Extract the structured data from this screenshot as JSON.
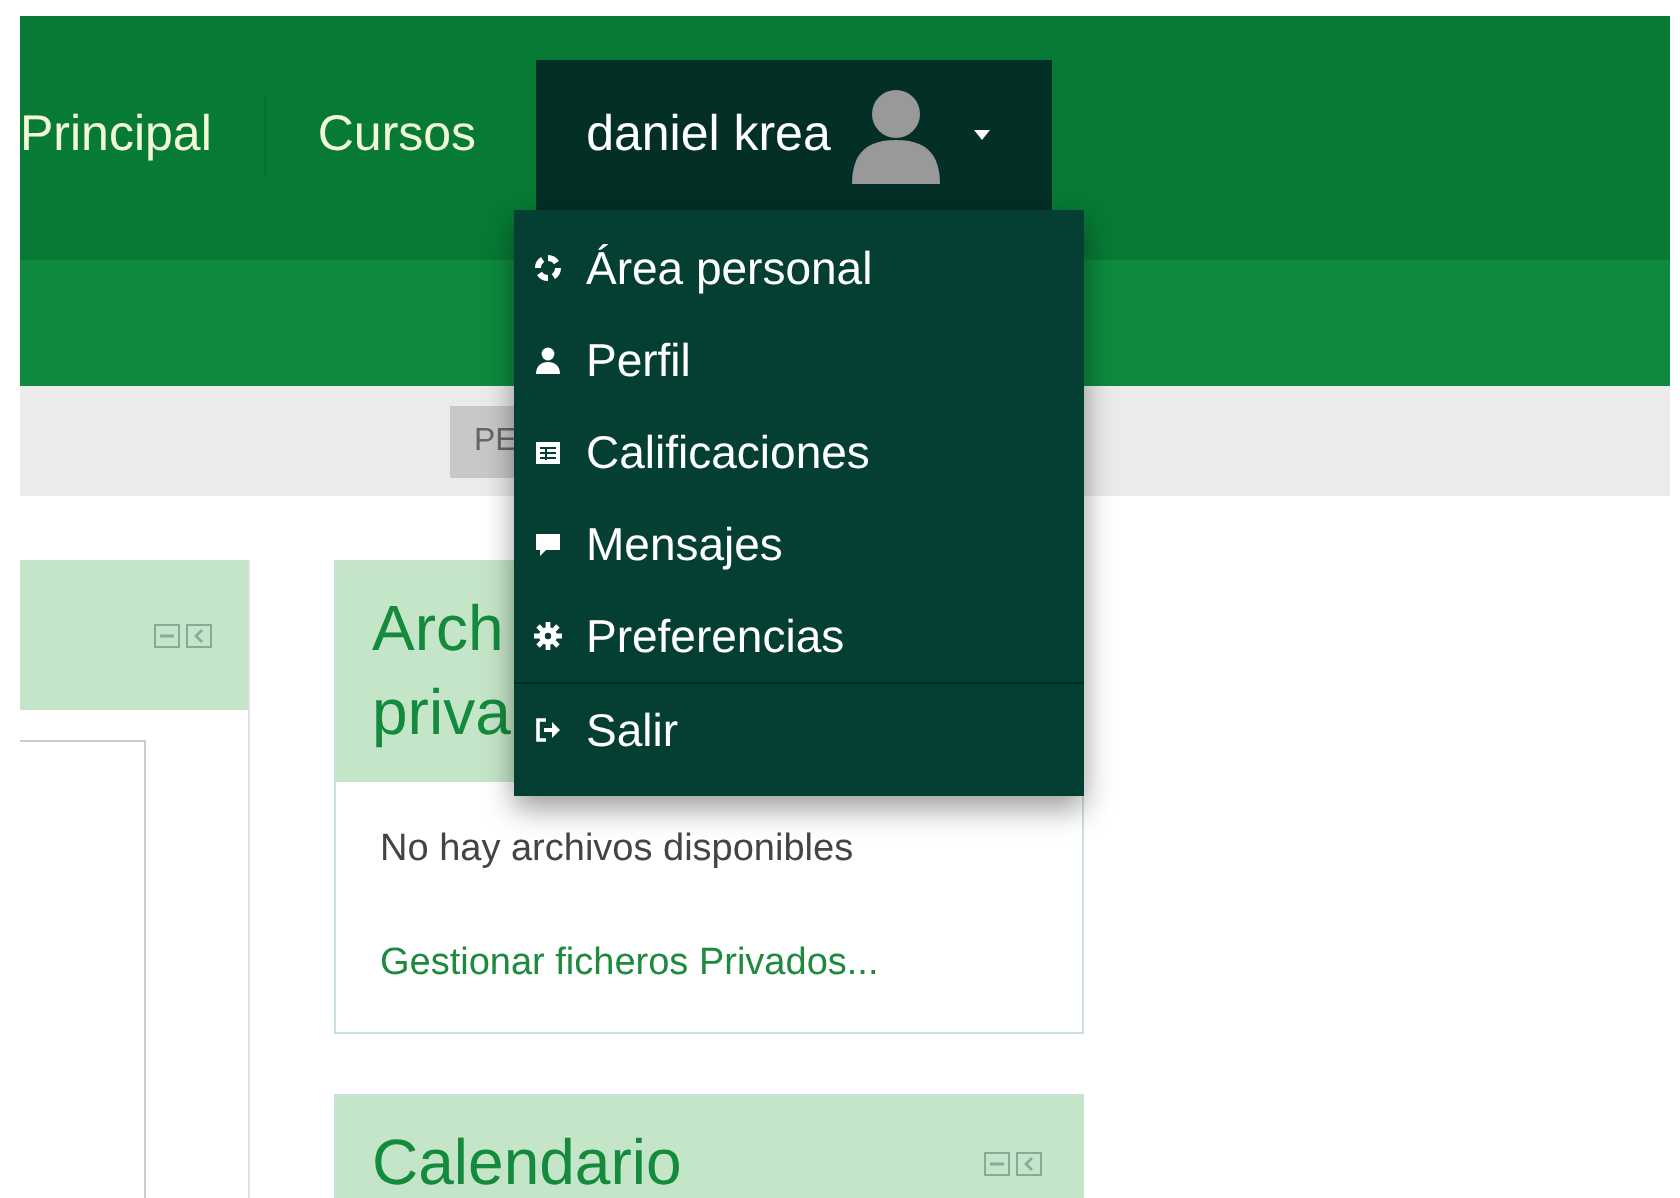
{
  "navbar": {
    "links": [
      {
        "label": "Principal"
      },
      {
        "label": "Cursos"
      }
    ],
    "user_menu": {
      "name": "daniel krea",
      "expanded": true,
      "items": [
        {
          "label": "Área personal",
          "kind": "dashboard"
        },
        {
          "label": "Perfil",
          "kind": "user"
        },
        {
          "label": "Calificaciones",
          "kind": "table"
        },
        {
          "label": "Mensajes",
          "kind": "comment"
        },
        {
          "label": "Preferencias",
          "kind": "cog"
        },
        {
          "label": "Salir",
          "kind": "signout"
        }
      ]
    }
  },
  "toolbar": {
    "button": "PE"
  },
  "blocks": [
    {
      "title_lines": [
        "Arch",
        "priva"
      ],
      "text": "No hay archivos disponibles",
      "link": "Gestionar ficheros Privados..."
    },
    {
      "title_lines": [
        "Calendario"
      ],
      "controls": true
    }
  ]
}
